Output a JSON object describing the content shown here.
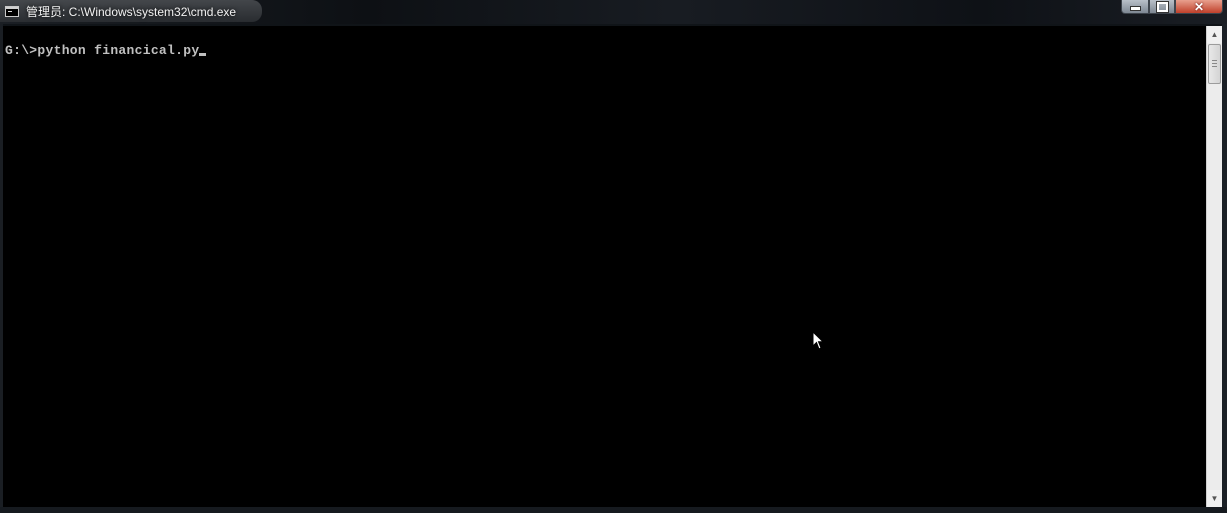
{
  "window": {
    "title": "管理员: C:\\Windows\\system32\\cmd.exe",
    "icon": "cmd-icon",
    "controls": {
      "minimize_icon": "minimize-icon",
      "maximize_icon": "maximize-icon",
      "close_icon": "close-icon",
      "close_glyph": "✕"
    }
  },
  "console": {
    "prompt": "G:\\>",
    "command": "python financical.py",
    "background": "#000000",
    "foreground": "#c0c0c0"
  },
  "scrollbar": {
    "up_glyph": "▲",
    "down_glyph": "▼"
  },
  "pointer": {
    "icon": "arrow-cursor-icon"
  }
}
